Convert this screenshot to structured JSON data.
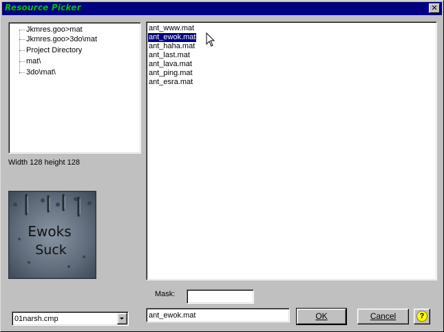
{
  "window": {
    "title": "Resource Picker",
    "close_glyph": "✕"
  },
  "tree": {
    "items": [
      {
        "label": "Jkmres.goo>mat"
      },
      {
        "label": "Jkmres.goo>3do\\mat"
      },
      {
        "label": "Project Directory"
      },
      {
        "label": "mat\\"
      },
      {
        "label": "3do\\mat\\"
      }
    ]
  },
  "preview": {
    "dimensions_text": "Width 128 height 128",
    "image_text_line1": "Ewoks",
    "image_text_line2": "Suck"
  },
  "files": {
    "items": [
      {
        "label": "ant_www.mat"
      },
      {
        "label": "ant_ewok.mat",
        "selected": true
      },
      {
        "label": "ant_haha.mat"
      },
      {
        "label": "ant_last.mat"
      },
      {
        "label": "ant_lava.mat"
      },
      {
        "label": "ant_ping.mat"
      },
      {
        "label": "ant_esra.mat"
      }
    ]
  },
  "mask": {
    "label": "Mask:",
    "value": ""
  },
  "colormap_combo": {
    "value": "01narsh.cmp"
  },
  "filename": {
    "value": "ant_ewok.mat"
  },
  "buttons": {
    "ok_label": "OK",
    "cancel_label": "Cancel",
    "help_glyph": "?"
  },
  "colors": {
    "titlebar": "#000080",
    "title_text": "#00c000",
    "face": "#c0c0c0",
    "selection": "#000080"
  },
  "icons": [
    "close-icon",
    "dropdown-arrow-icon",
    "help-icon",
    "mouse-cursor-icon"
  ]
}
